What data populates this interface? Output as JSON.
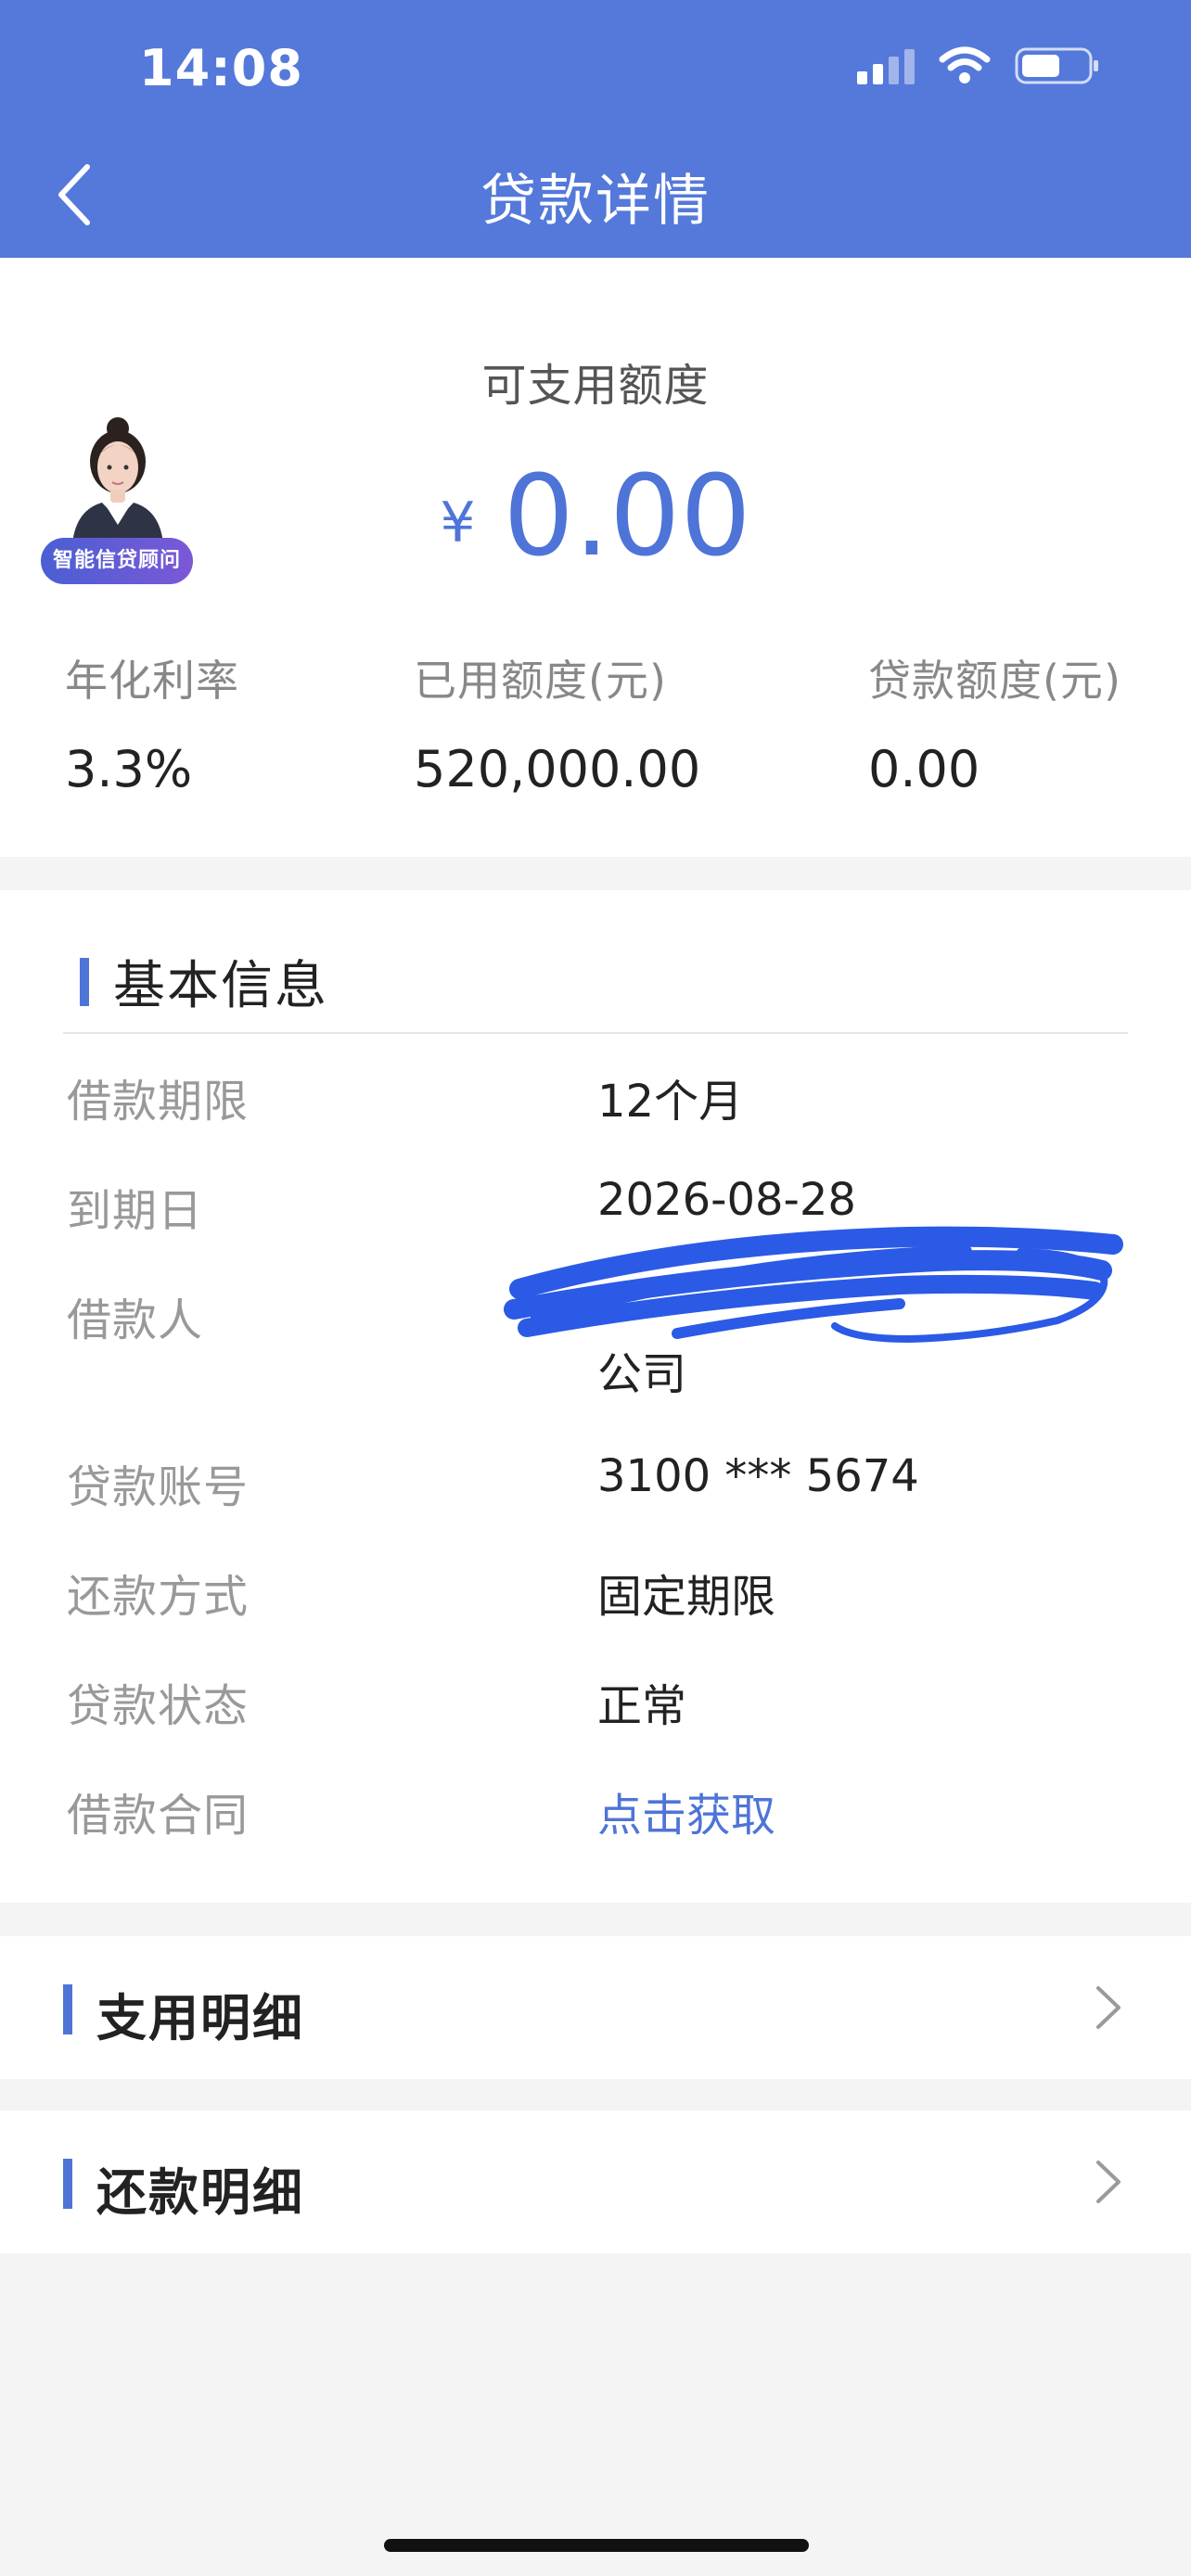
{
  "status_bar": {
    "time": "14:08"
  },
  "header": {
    "title": "贷款详情"
  },
  "summary": {
    "available_label": "可支用额度",
    "currency_symbol": "¥",
    "available_amount": "0.00",
    "advisor_badge": "智能信贷顾问",
    "stats": [
      {
        "label": "年化利率",
        "value": "3.3%"
      },
      {
        "label": "已用额度(元)",
        "value": "520,000.00"
      },
      {
        "label": "贷款额度(元)",
        "value": "0.00"
      }
    ]
  },
  "basic_info": {
    "title": "基本信息",
    "rows": [
      {
        "key": "借款期限",
        "value": "12个月"
      },
      {
        "key": "到期日",
        "value": "2026-08-28"
      },
      {
        "key": "借款人",
        "value": "公司"
      },
      {
        "key": "贷款账号",
        "value": "3100 *** 5674"
      },
      {
        "key": "还款方式",
        "value": "固定期限"
      },
      {
        "key": "贷款状态",
        "value": "正常"
      },
      {
        "key": "借款合同",
        "value": "点击获取"
      }
    ]
  },
  "details": [
    {
      "label": "支用明细"
    },
    {
      "label": "还款明细"
    }
  ],
  "colors": {
    "header_bg": "#5479db",
    "accent": "#4f74d8",
    "page_bg": "#f4f4f4"
  }
}
